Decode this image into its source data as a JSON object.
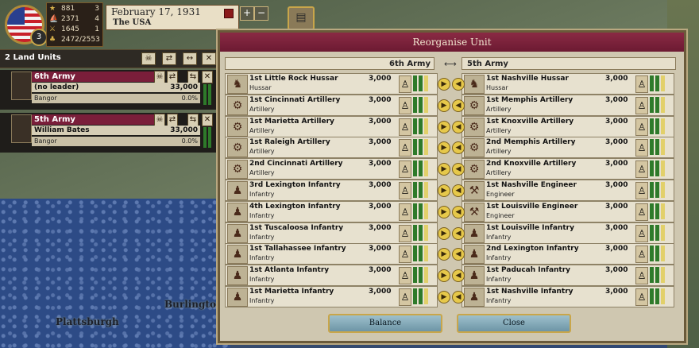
{
  "hud": {
    "rank": "3",
    "stats": [
      {
        "icon": "★",
        "value": "881",
        "right": "3"
      },
      {
        "icon": "⛵",
        "value": "2371",
        "right": "4"
      },
      {
        "icon": "⚔",
        "value": "1645",
        "right": "1"
      },
      {
        "icon": "♣",
        "value": "2472/2553",
        "right": ""
      }
    ],
    "date": "February 17, 1931",
    "nation": "The USA"
  },
  "map": {
    "labels": [
      "Plattsburgh",
      "Burlington"
    ]
  },
  "unit_list": {
    "title": "2 Land Units",
    "armies": [
      {
        "name": "6th Army",
        "leader": "(no leader)",
        "strength": "33,000",
        "location": "Bangor",
        "org": "0.0%"
      },
      {
        "name": "5th Army",
        "leader": "William Bates",
        "strength": "33,000",
        "location": "Bangor",
        "org": "0.0%"
      }
    ]
  },
  "dialog": {
    "title": "Reorganise Unit",
    "left_army": "6th Army",
    "right_army": "5th Army",
    "left_units": [
      {
        "name": "1st Little Rock Hussar",
        "type": "Hussar",
        "strength": "3,000"
      },
      {
        "name": "1st Cincinnati Artillery",
        "type": "Artillery",
        "strength": "3,000"
      },
      {
        "name": "1st Marietta Artillery",
        "type": "Artillery",
        "strength": "3,000"
      },
      {
        "name": "1st Raleigh Artillery",
        "type": "Artillery",
        "strength": "3,000"
      },
      {
        "name": "2nd Cincinnati Artillery",
        "type": "Artillery",
        "strength": "3,000"
      },
      {
        "name": "3rd Lexington Infantry",
        "type": "Infantry",
        "strength": "3,000"
      },
      {
        "name": "4th Lexington Infantry",
        "type": "Infantry",
        "strength": "3,000"
      },
      {
        "name": "1st Tuscaloosa Infantry",
        "type": "Infantry",
        "strength": "3,000"
      },
      {
        "name": "1st Tallahassee Infantry",
        "type": "Infantry",
        "strength": "3,000"
      },
      {
        "name": "1st Atlanta Infantry",
        "type": "Infantry",
        "strength": "3,000"
      },
      {
        "name": "1st Marietta Infantry",
        "type": "Infantry",
        "strength": "3,000"
      }
    ],
    "right_units": [
      {
        "name": "1st Nashville Hussar",
        "type": "Hussar",
        "strength": "3,000"
      },
      {
        "name": "1st Memphis Artillery",
        "type": "Artillery",
        "strength": "3,000"
      },
      {
        "name": "1st Knoxville Artillery",
        "type": "Artillery",
        "strength": "3,000"
      },
      {
        "name": "2nd Memphis Artillery",
        "type": "Artillery",
        "strength": "3,000"
      },
      {
        "name": "2nd Knoxville Artillery",
        "type": "Artillery",
        "strength": "3,000"
      },
      {
        "name": "1st Nashville Engineer",
        "type": "Engineer",
        "strength": "3,000"
      },
      {
        "name": "1st Louisville Engineer",
        "type": "Engineer",
        "strength": "3,000"
      },
      {
        "name": "1st Louisville Infantry",
        "type": "Infantry",
        "strength": "3,000"
      },
      {
        "name": "2nd Lexington Infantry",
        "type": "Infantry",
        "strength": "3,000"
      },
      {
        "name": "1st Paducah Infantry",
        "type": "Infantry",
        "strength": "3,000"
      },
      {
        "name": "1st Nashville Infantry",
        "type": "Infantry",
        "strength": "3,000"
      }
    ],
    "balance_label": "Balance",
    "close_label": "Close"
  }
}
